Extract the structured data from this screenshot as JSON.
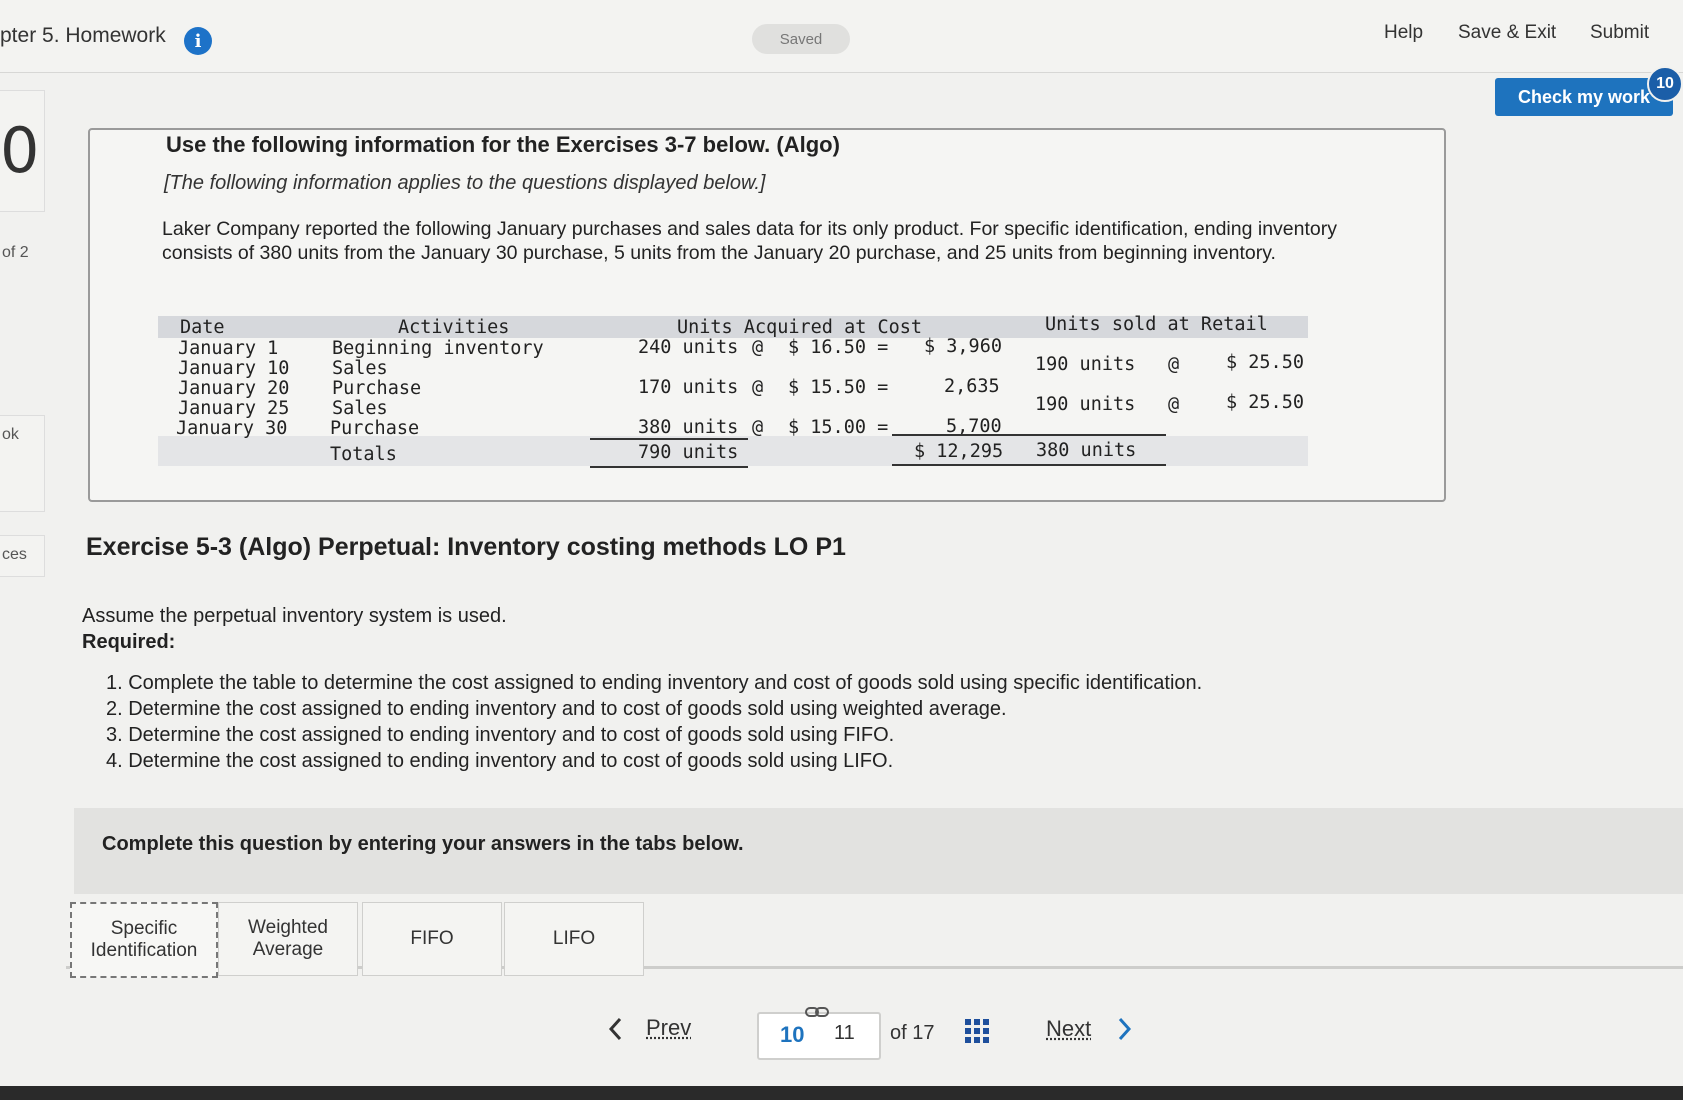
{
  "header": {
    "title": "pter 5. Homework",
    "saved": "Saved",
    "help": "Help",
    "save_exit": "Save & Exit",
    "submit": "Submit",
    "check_my_work": "Check my work",
    "check_badge": "10"
  },
  "sidebar": {
    "big_number": "0",
    "of_label": "of 2",
    "item1": "ok",
    "item2": "ces"
  },
  "info": {
    "heading": "Use the following information for the Exercises 3-7 below. (Algo)",
    "subheading": "[The following information applies to the questions displayed below.]",
    "paragraph": "Laker Company reported the following January purchases and sales data for its only product. For specific identification, ending inventory consists of 380 units from the January 30 purchase, 5 units from the January 20 purchase, and 25 units from beginning inventory.",
    "table": {
      "headers": {
        "date": "Date",
        "activities": "Activities",
        "units_acquired": "Units Acquired at Cost",
        "units_sold": "Units sold at Retail"
      },
      "rows": [
        {
          "date": "January 1",
          "activity": "Beginning inventory",
          "acq_units": "240 units",
          "acq_at": "@",
          "acq_cost": "$ 16.50 =",
          "acq_total": "$ 3,960",
          "sold_units": "",
          "sold_at": "",
          "sold_price": ""
        },
        {
          "date": "January 10",
          "activity": "Sales",
          "acq_units": "",
          "acq_at": "",
          "acq_cost": "",
          "acq_total": "",
          "sold_units": "190 units",
          "sold_at": "@",
          "sold_price": "$ 25.50"
        },
        {
          "date": "January 20",
          "activity": "Purchase",
          "acq_units": "170 units",
          "acq_at": "@",
          "acq_cost": "$ 15.50 =",
          "acq_total": "2,635",
          "sold_units": "",
          "sold_at": "",
          "sold_price": ""
        },
        {
          "date": "January 25",
          "activity": "Sales",
          "acq_units": "",
          "acq_at": "",
          "acq_cost": "",
          "acq_total": "",
          "sold_units": "190 units",
          "sold_at": "@",
          "sold_price": "$ 25.50"
        },
        {
          "date": "January 30",
          "activity": "Purchase",
          "acq_units": "380 units",
          "acq_at": "@",
          "acq_cost": "$ 15.00 =",
          "acq_total": "5,700",
          "sold_units": "",
          "sold_at": "",
          "sold_price": ""
        }
      ],
      "totals": {
        "label": "Totals",
        "acq_units": "790 units",
        "acq_total": "$ 12,295",
        "sold_units": "380 units"
      }
    }
  },
  "exercise": {
    "title": "Exercise 5-3 (Algo) Perpetual: Inventory costing methods LO P1",
    "assume": "Assume the perpetual inventory system is used.",
    "required": "Required:",
    "items": [
      "1. Complete the table to determine the cost assigned to ending inventory and cost of goods sold using specific identification.",
      "2. Determine the cost assigned to ending inventory and to cost of goods sold using weighted average.",
      "3. Determine the cost assigned to ending inventory and to cost of goods sold using FIFO.",
      "4. Determine the cost assigned to ending inventory and to cost of goods sold using LIFO."
    ]
  },
  "complete_prompt": "Complete this question by entering your answers in the tabs below.",
  "tabs": [
    {
      "line1": "Specific",
      "line2": "Identification"
    },
    {
      "line1": "Weighted",
      "line2": "Average"
    },
    {
      "line1": "FIFO",
      "line2": ""
    },
    {
      "line1": "LIFO",
      "line2": ""
    }
  ],
  "pager": {
    "prev": "Prev",
    "current": "10",
    "next_page": "11",
    "of": "of 17",
    "next": "Next"
  }
}
